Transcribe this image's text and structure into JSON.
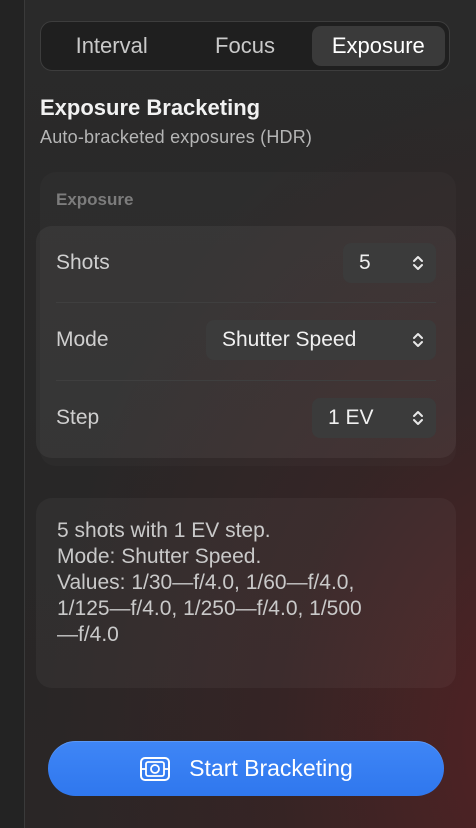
{
  "tabs": [
    {
      "label": "Interval",
      "active": false
    },
    {
      "label": "Focus",
      "active": false
    },
    {
      "label": "Exposure",
      "active": true
    }
  ],
  "header": {
    "title": "Exposure Bracketing",
    "subtitle": "Auto-bracketed exposures (HDR)"
  },
  "section": {
    "label": "Exposure",
    "rows": [
      {
        "label": "Shots",
        "value": "5"
      },
      {
        "label": "Mode",
        "value": "Shutter Speed"
      },
      {
        "label": "Step",
        "value": "1 EV"
      }
    ]
  },
  "info": {
    "line1": "5 shots with 1 EV step.",
    "line2": "Mode: Shutter Speed.",
    "line3": "Values: 1/30—f/4.0, 1/60—f/4.0,",
    "line4": "1/125—f/4.0, 1/250—f/4.0, 1/500",
    "line5": "—f/4.0"
  },
  "action": {
    "label": "Start Bracketing",
    "icon": "bracketing-icon",
    "color": "#3a82f4"
  },
  "colors": {
    "accent": "#3a82f4",
    "background": "#2a2a2a"
  }
}
